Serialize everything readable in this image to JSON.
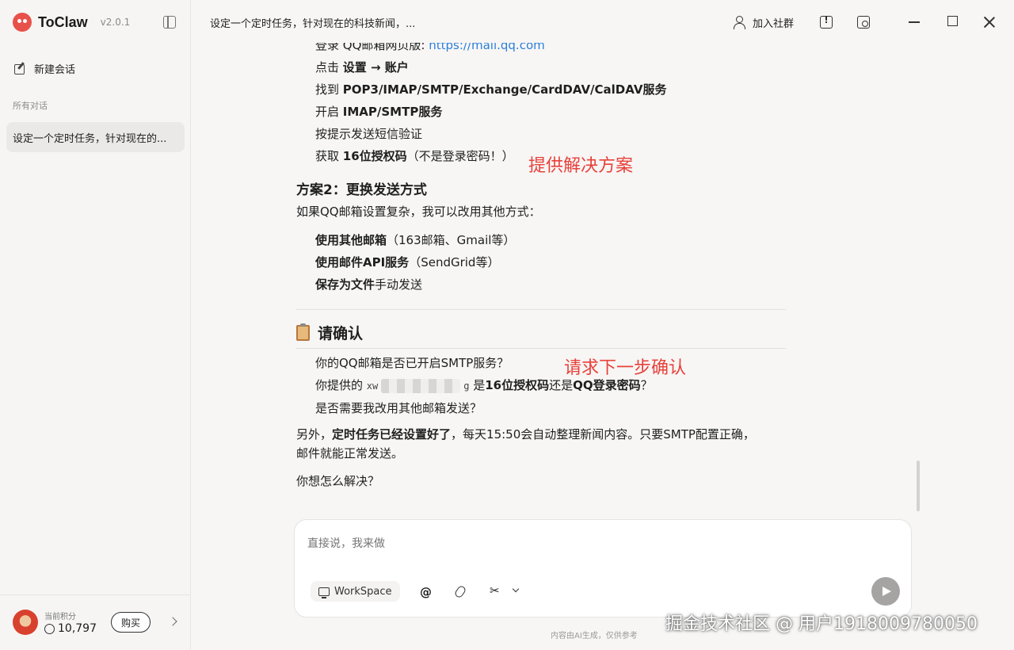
{
  "app": {
    "name": "ToClaw",
    "version": "v2.0.1"
  },
  "sidebar": {
    "new_chat": "新建会话",
    "section": "所有对话",
    "conversations": [
      "设定一个定时任务，针对现在的..."
    ],
    "points_label": "当前积分",
    "points_value": "10,797",
    "buy": "购买"
  },
  "header": {
    "title": "设定一个定时任务，针对现在的科技新闻，...",
    "join": "加入社群"
  },
  "chat": {
    "lines": {
      "login_prefix": "登录 QQ邮箱网页版: ",
      "login_url": "https://mail.qq.com",
      "s1a": "点击 ",
      "s1b": "设置 → 账户",
      "s2a": "找到 ",
      "s2b": "POP3/IMAP/SMTP/Exchange/CardDAV/CalDAV服务",
      "s3a": "开启 ",
      "s3b": "IMAP/SMTP服务",
      "s4": "按提示发送短信验证",
      "s5a": "获取 ",
      "s5b": "16位授权码",
      "s5c": "（不是登录密码！）",
      "plan2_title": "方案2：更换发送方式",
      "plan2_intro": "如果QQ邮箱设置复杂，我可以改用其他方式：",
      "o1a": "使用其他邮箱",
      "o1b": "（163邮箱、Gmail等）",
      "o2a": "使用邮件API服务",
      "o2b": "（SendGrid等）",
      "o3a": "保存为文件",
      "o3b": "手动发送",
      "confirm_title": "请确认",
      "q1": "你的QQ邮箱是否已开启SMTP服务？",
      "q2a": "你提供的 ",
      "q2_code_start": "xw",
      "q2_code_end": "g",
      "q2b": " 是",
      "q2c": "16位授权码",
      "q2d": "还是",
      "q2e": "QQ登录密码",
      "q2f": "？",
      "q3": "是否需要我改用其他邮箱发送？",
      "p1a": "另外，",
      "p1b": "定时任务已经设置好了",
      "p1c": "，每天15:50会自动整理新闻内容。只要SMTP配置正确，",
      "p1d": "邮件就能正常发送。",
      "p2": "你想怎么解决？"
    },
    "annotations": {
      "a1": "提供解决方案",
      "a2": "请求下一步确认"
    }
  },
  "composer": {
    "placeholder": "直接说，我来做",
    "workspace": "WorkSpace",
    "at": "@",
    "scissors": "✂"
  },
  "footer": {
    "disclaimer": "内容由AI生成，仅供参考"
  },
  "watermark": "掘金技术社区 @ 用户1918009780050"
}
